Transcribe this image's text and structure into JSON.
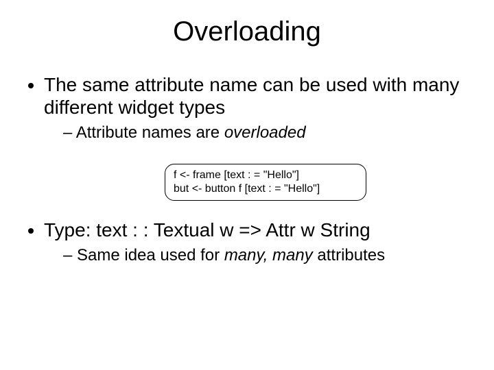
{
  "title": "Overloading",
  "bullets": {
    "b1": "The same attribute name can be used with many different widget types",
    "b1_sub_pre": "Attribute names are ",
    "b1_sub_em": "overloaded",
    "b2": "Type: text : : Textual w => Attr w String",
    "b2_sub_pre": "Same idea used for ",
    "b2_sub_em": "many, many",
    "b2_sub_post": " attributes"
  },
  "code": {
    "line1": "f <- frame [text : = \"Hello\"]",
    "line2": "but <- button f [text : = \"Hello\"]"
  }
}
